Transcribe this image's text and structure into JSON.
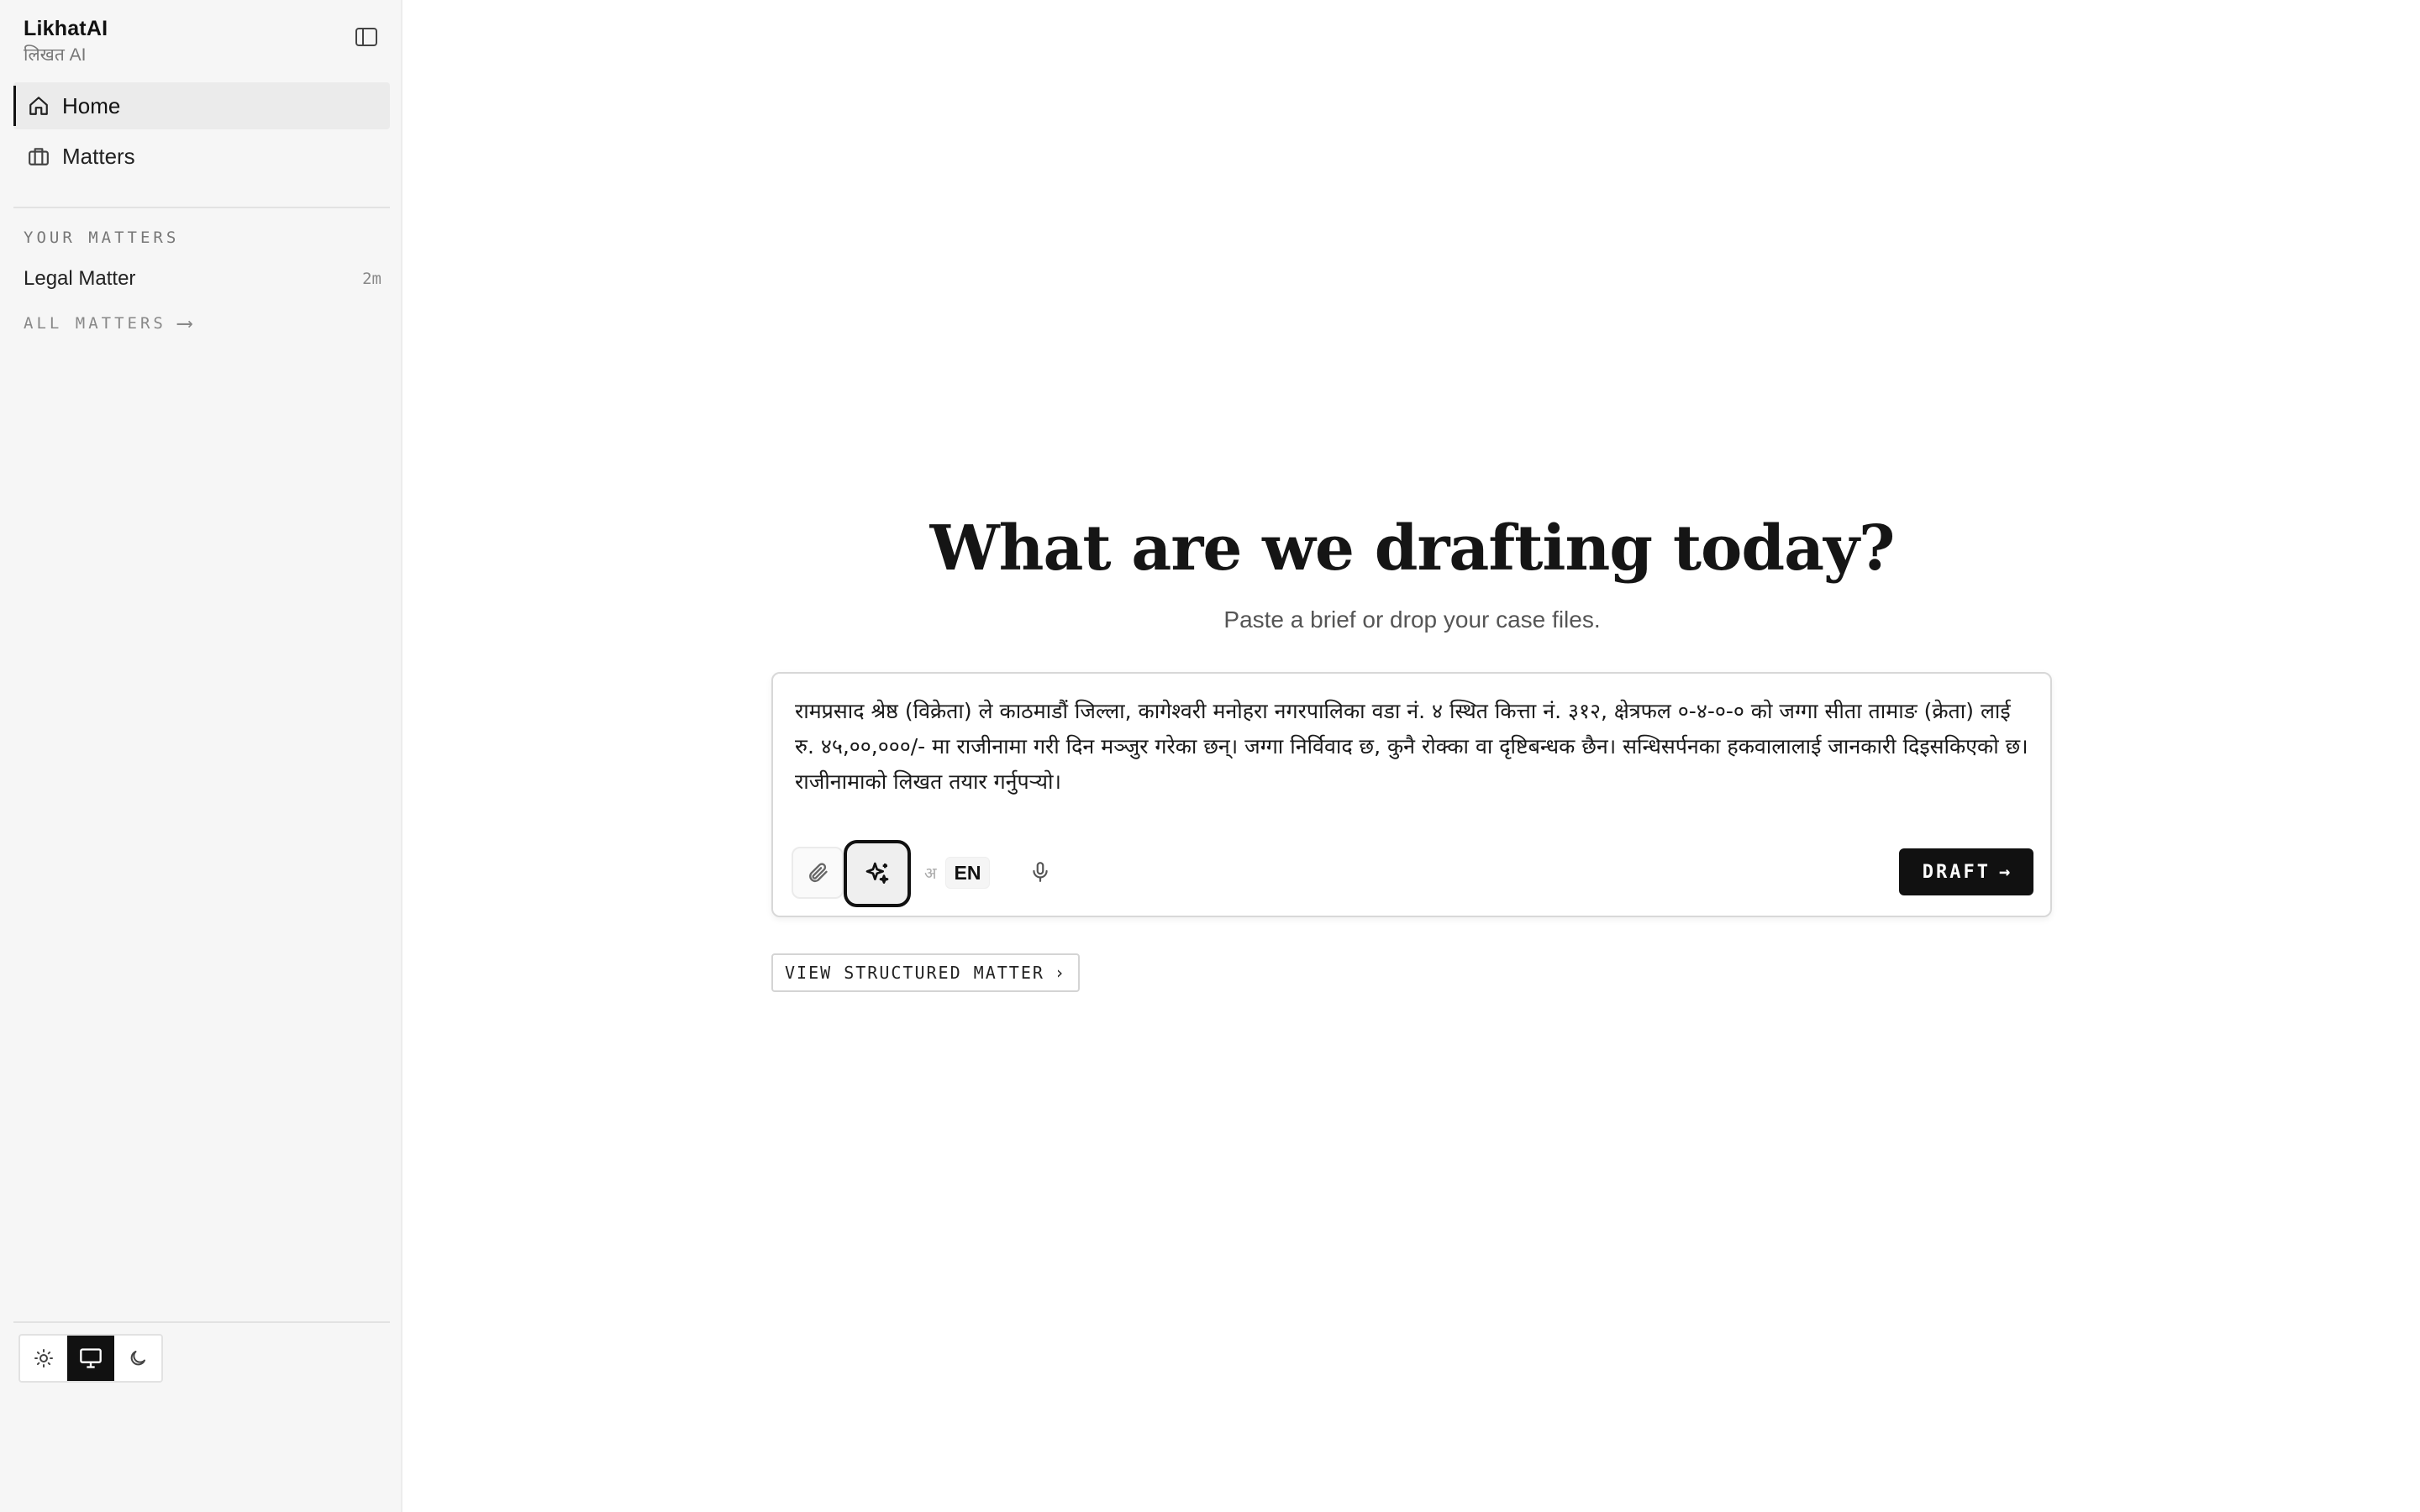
{
  "brand": {
    "name": "LikhatAI",
    "subtitle": "लिखत AI"
  },
  "sidebar": {
    "nav": [
      {
        "label": "Home",
        "icon": "home-icon",
        "active": true
      },
      {
        "label": "Matters",
        "icon": "briefcase-icon",
        "active": false
      }
    ],
    "section_label": "YOUR MATTERS",
    "matters": [
      {
        "name": "Legal Matter",
        "time": "2m"
      }
    ],
    "all_matters_label": "ALL MATTERS",
    "all_matters_arrow": "⟶",
    "theme_options": [
      {
        "name": "sun-icon",
        "active": false
      },
      {
        "name": "monitor-icon",
        "active": true
      },
      {
        "name": "moon-icon",
        "active": false
      }
    ]
  },
  "main": {
    "headline": "What are we drafting today?",
    "subheadline": "Paste a brief or drop your case files.",
    "composer": {
      "text": "रामप्रसाद श्रेष्ठ (विक्रेता) ले काठमाडौं जिल्ला, कागेश्वरी मनोहरा नगरपालिका वडा नं. ४ स्थित कित्ता नं. ३१२, क्षेत्रफल ०-४-०-० को जग्गा सीता तामाङ (क्रेता) लाई रु. ४५,००,०००/- मा राजीनामा गरी दिन मञ्जुर गरेका छन्। जग्गा निर्विवाद छ, कुनै रोक्का वा दृष्टिबन्धक छैन। सन्धिसर्पनका हकवालालाई जानकारी दिइसकिएको छ। राजीनामाको लिखत तयार गर्नुपर्‍यो।",
      "lang_options": [
        "अ",
        "EN"
      ],
      "lang_selected": "EN",
      "draft_label": "DRAFT",
      "draft_arrow": "→"
    },
    "structured_label": "VIEW STRUCTURED MATTER",
    "structured_chevron": "›"
  },
  "colors": {
    "accent": "#111111",
    "sidebar_bg": "#f6f6f6",
    "muted": "#777777"
  }
}
